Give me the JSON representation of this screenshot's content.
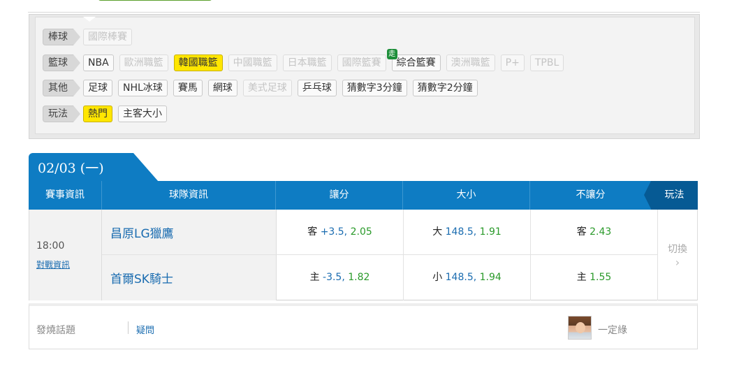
{
  "filters": {
    "rows": [
      {
        "label": "棒球",
        "chips": [
          {
            "text": "國際棒賽",
            "state": "disabled"
          }
        ]
      },
      {
        "label": "籃球",
        "chips": [
          {
            "text": "NBA",
            "state": "normal"
          },
          {
            "text": "歐洲職籃",
            "state": "disabled"
          },
          {
            "text": "韓國職籃",
            "state": "active"
          },
          {
            "text": "中國職籃",
            "state": "disabled"
          },
          {
            "text": "日本職籃",
            "state": "disabled"
          },
          {
            "text": "國際籃賽",
            "state": "disabled"
          },
          {
            "text": "綜合籃賽",
            "state": "normal",
            "badge": "走"
          },
          {
            "text": "澳洲職籃",
            "state": "disabled"
          },
          {
            "text": "P+",
            "state": "disabled"
          },
          {
            "text": "TPBL",
            "state": "disabled"
          }
        ]
      },
      {
        "label": "其他",
        "chips": [
          {
            "text": "足球",
            "state": "normal"
          },
          {
            "text": "NHL冰球",
            "state": "normal"
          },
          {
            "text": "賽馬",
            "state": "normal"
          },
          {
            "text": "網球",
            "state": "normal"
          },
          {
            "text": "美式足球",
            "state": "disabled"
          },
          {
            "text": "乒乓球",
            "state": "normal"
          },
          {
            "text": "猜數字3分鐘",
            "state": "normal"
          },
          {
            "text": "猜數字2分鐘",
            "state": "normal"
          }
        ]
      },
      {
        "label": "玩法",
        "chips": [
          {
            "text": "熱門",
            "state": "active"
          },
          {
            "text": "主客大小",
            "state": "normal"
          }
        ]
      }
    ]
  },
  "date_tab": "02/03 (一)",
  "table": {
    "headers": {
      "event_info": "賽事資訊",
      "team_info": "球隊資訊",
      "handicap": "讓分",
      "over_under": "大小",
      "moneyline": "不讓分",
      "play": "玩法"
    },
    "game": {
      "time": "18:00",
      "vs_link": "對戰資訊",
      "teams": [
        {
          "name": "昌原LG獵鷹",
          "handicap": {
            "label": "客",
            "line": "+3.5,",
            "odds": "2.05"
          },
          "over_under": {
            "label": "大",
            "line": "148.5,",
            "odds": "1.91"
          },
          "moneyline": {
            "label": "客",
            "odds": "2.43"
          }
        },
        {
          "name": "首爾SK騎士",
          "handicap": {
            "label": "主",
            "line": "-3.5,",
            "odds": "1.82"
          },
          "over_under": {
            "label": "小",
            "line": "148.5,",
            "odds": "1.94"
          },
          "moneyline": {
            "label": "主",
            "odds": "1.55"
          }
        }
      ],
      "switch_label": "切換",
      "switch_arrow": "›"
    }
  },
  "bottom": {
    "hot_topic": "發燒話題",
    "question": "疑問",
    "username": "一定綠"
  },
  "colors": {
    "header_blue": "#0e7cc3",
    "play_header": "#065a94",
    "active_chip": "#ffe600",
    "odds_green": "#2a9a2a",
    "link_blue": "#1a6cb0"
  }
}
